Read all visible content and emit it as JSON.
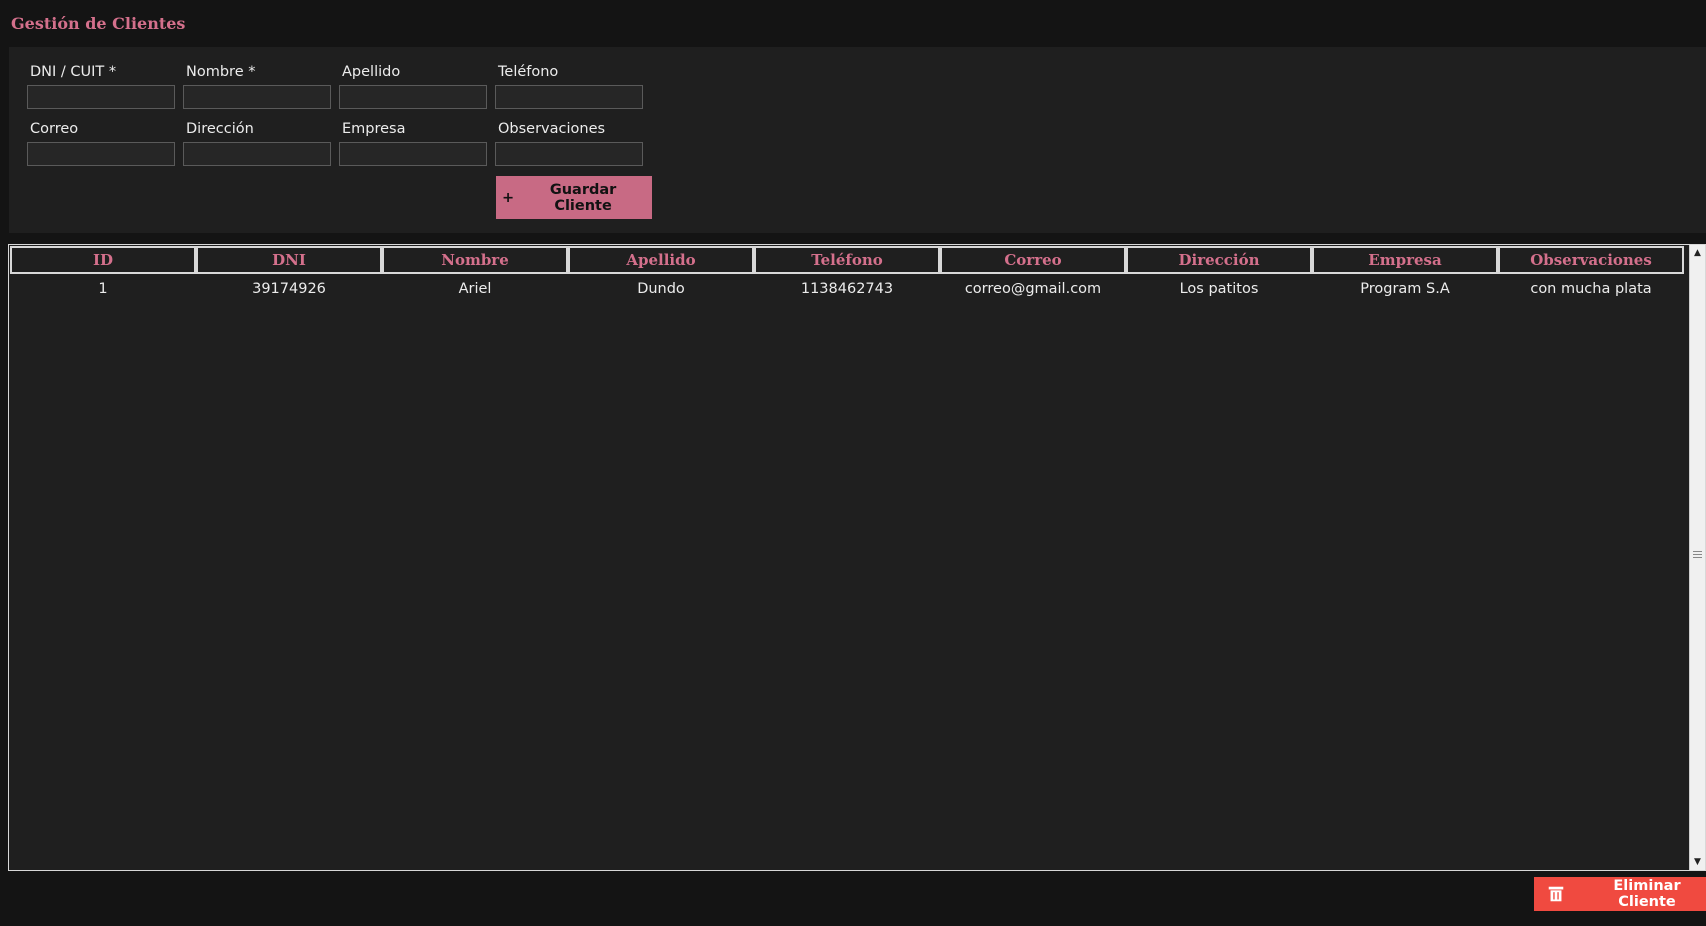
{
  "header": {
    "title": "Gestión de Clientes"
  },
  "form": {
    "fields": [
      {
        "label": "DNI / CUIT *",
        "value": ""
      },
      {
        "label": "Nombre *",
        "value": ""
      },
      {
        "label": "Apellido",
        "value": ""
      },
      {
        "label": "Teléfono",
        "value": ""
      },
      {
        "label": "Correo",
        "value": ""
      },
      {
        "label": "Dirección",
        "value": ""
      },
      {
        "label": "Empresa",
        "value": ""
      },
      {
        "label": "Observaciones",
        "value": ""
      }
    ],
    "save_icon": "+",
    "save_label": "Guardar Cliente",
    "accent_color": "#c86a84"
  },
  "table": {
    "columns": [
      "ID",
      "DNI",
      "Nombre",
      "Apellido",
      "Teléfono",
      "Correo",
      "Dirección",
      "Empresa",
      "Observaciones"
    ],
    "rows": [
      [
        "1",
        "39174926",
        "Ariel",
        "Dundo",
        "1138462743",
        "correo@gmail.com",
        "Los patitos",
        "Program S.A",
        "con mucha plata"
      ]
    ]
  },
  "footer": {
    "delete_label": "Eliminar Cliente",
    "delete_icon": "trash-icon",
    "delete_color": "#f04a40"
  }
}
